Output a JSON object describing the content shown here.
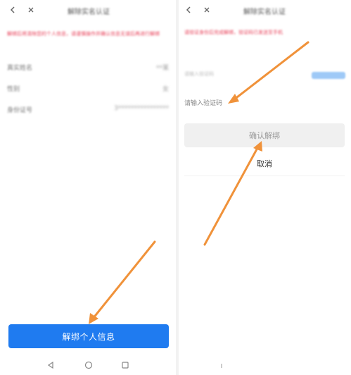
{
  "left": {
    "topbar": {
      "title": "解除实名认证"
    },
    "warning": "解绑后将清除您的个人信息，请谨慎操作并确认信息无误后再进行解绑",
    "rows": [
      {
        "label": "真实姓名",
        "value": "**某"
      },
      {
        "label": "性别",
        "value": "女"
      },
      {
        "label": "身份证号",
        "value": "3****************"
      }
    ],
    "unbind_button": "解绑个人信息"
  },
  "right": {
    "topbar": {
      "title": "解除实名认证"
    },
    "warning": "请验证身份后完成解绑，验证码已发送至手机",
    "code_placeholder": "请输入验证码",
    "code_hint": "请输入验证码",
    "confirm_button": "确认解绑",
    "cancel_button": "取消"
  },
  "colors": {
    "primary": "#1f7bf0",
    "warning": "#e8425a",
    "annotation_arrow": "#f0923a"
  },
  "icons": {
    "back": "back-arrow-icon",
    "close": "close-icon",
    "nav_back": "nav-back-icon",
    "nav_home": "nav-home-icon",
    "nav_recent": "nav-recent-icon"
  }
}
